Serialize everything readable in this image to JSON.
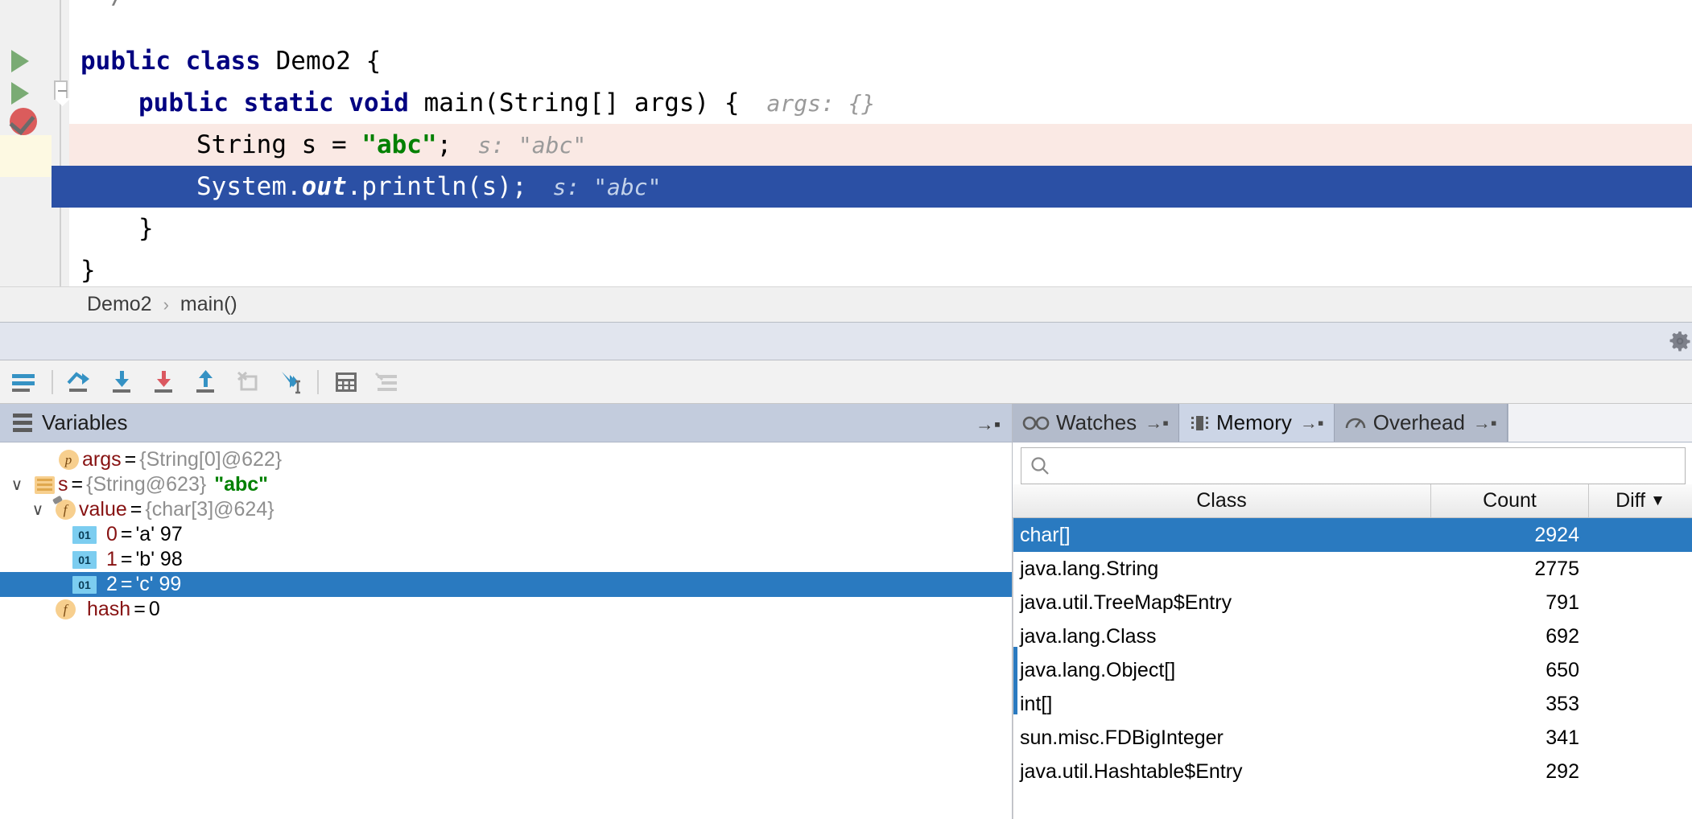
{
  "editor": {
    "top_fragment": "**/",
    "lines": [
      {
        "indent": 0,
        "segments": [
          {
            "t": "public ",
            "c": "kw"
          },
          {
            "t": "class ",
            "c": "kw"
          },
          {
            "t": "Demo2 {",
            "c": "plain"
          }
        ],
        "hint": "",
        "state": "normal",
        "gutter": "run-arrow",
        "fold": ""
      },
      {
        "indent": 1,
        "segments": [
          {
            "t": "public ",
            "c": "kw"
          },
          {
            "t": "static ",
            "c": "kw"
          },
          {
            "t": "void ",
            "c": "kw"
          },
          {
            "t": "main(String[] args) {",
            "c": "plain"
          }
        ],
        "hint": "args: {}",
        "state": "normal",
        "gutter": "run-arrow",
        "fold": "fold-minus"
      },
      {
        "indent": 2,
        "segments": [
          {
            "t": "String s = ",
            "c": "plain"
          },
          {
            "t": "\"abc\"",
            "c": "str"
          },
          {
            "t": ";",
            "c": "plain"
          }
        ],
        "hint": "s: \"abc\"",
        "state": "breakpoint",
        "gutter": "breakpoint",
        "fold": ""
      },
      {
        "indent": 2,
        "segments": [
          {
            "t": "System.",
            "c": "plain"
          },
          {
            "t": "out",
            "c": "fld"
          },
          {
            "t": ".println(s);",
            "c": "plain"
          }
        ],
        "hint": "s: \"abc\"",
        "state": "selected",
        "gutter": "",
        "fold": ""
      },
      {
        "indent": 1,
        "segments": [
          {
            "t": "}",
            "c": "plain"
          }
        ],
        "hint": "",
        "state": "normal",
        "gutter": "",
        "fold": "fold-up"
      },
      {
        "indent": 0,
        "segments": [
          {
            "t": "}",
            "c": "plain"
          }
        ],
        "hint": "",
        "state": "normal",
        "gutter": "",
        "fold": ""
      }
    ]
  },
  "breadcrumb": {
    "class_name": "Demo2",
    "separator": "›",
    "method_name": "main()"
  },
  "debug_toolbar": {
    "buttons": [
      {
        "name": "show-execution-point-icon",
        "label": "Show Execution Point"
      },
      {
        "name": "step-over-icon",
        "label": "Step Over"
      },
      {
        "name": "step-into-icon",
        "label": "Step Into"
      },
      {
        "name": "force-step-into-icon",
        "label": "Force Step Into"
      },
      {
        "name": "step-out-icon",
        "label": "Step Out"
      },
      {
        "name": "drop-frame-icon",
        "label": "Drop Frame"
      },
      {
        "name": "run-to-cursor-icon",
        "label": "Run to Cursor"
      },
      {
        "name": "evaluate-expression-icon",
        "label": "Evaluate Expression"
      },
      {
        "name": "mute-breakpoints-icon",
        "label": "Settings"
      }
    ]
  },
  "variables_panel": {
    "title": "Variables",
    "pin_glyph": "→▪",
    "rows": [
      {
        "depth": 0,
        "twisty": "",
        "icon": "param",
        "icon_text": "p",
        "name": "args",
        "eq": "=",
        "ref": "{String[0]@622}",
        "value": "",
        "num": "",
        "selected": false
      },
      {
        "depth": 0,
        "twisty": "∨",
        "icon": "array",
        "icon_text": "",
        "name": "s",
        "eq": "=",
        "ref": "{String@623}",
        "value": "\"abc\"",
        "num": "",
        "selected": false
      },
      {
        "depth": 1,
        "twisty": "∨",
        "icon": "field-wrench",
        "icon_text": "f",
        "name": "value",
        "eq": "=",
        "ref": "{char[3]@624}",
        "value": "",
        "num": "",
        "selected": false
      },
      {
        "depth": 2,
        "twisty": "",
        "icon": "prim01",
        "icon_text": "01",
        "name": "0",
        "eq": "=",
        "ref": "",
        "value": "'a' 97",
        "num": "",
        "selected": false
      },
      {
        "depth": 2,
        "twisty": "",
        "icon": "prim01",
        "icon_text": "01",
        "name": "1",
        "eq": "=",
        "ref": "",
        "value": "'b' 98",
        "num": "",
        "selected": false
      },
      {
        "depth": 2,
        "twisty": "",
        "icon": "prim01",
        "icon_text": "01",
        "name": "2",
        "eq": "=",
        "ref": "",
        "value": "'c' 99",
        "num": "",
        "selected": true
      },
      {
        "depth": 1,
        "twisty": "",
        "icon": "field",
        "icon_text": "f",
        "name": "hash",
        "eq": "=",
        "ref": "",
        "value": "0",
        "num": "",
        "selected": false
      }
    ]
  },
  "right_panel": {
    "tabs": [
      {
        "label": "Watches",
        "icon": "glasses-icon",
        "pin": "→▪",
        "active": false
      },
      {
        "label": "Memory",
        "icon": "memory-chip-icon",
        "pin": "→▪",
        "active": true
      },
      {
        "label": "Overhead",
        "icon": "gauge-icon",
        "pin": "→▪",
        "active": false
      }
    ],
    "search": {
      "placeholder": "",
      "value": ""
    },
    "memory_table": {
      "columns": [
        "Class",
        "Count",
        "Diff"
      ],
      "sort_indicator": "▼",
      "rows": [
        {
          "class": "char[]",
          "count": "2924",
          "diff": "",
          "selected": true
        },
        {
          "class": "java.lang.String",
          "count": "2775",
          "diff": "",
          "selected": false
        },
        {
          "class": "java.util.TreeMap$Entry",
          "count": "791",
          "diff": "",
          "selected": false
        },
        {
          "class": "java.lang.Class",
          "count": "692",
          "diff": "",
          "selected": false
        },
        {
          "class": "java.lang.Object[]",
          "count": "650",
          "diff": "",
          "selected": false
        },
        {
          "class": "int[]",
          "count": "353",
          "diff": "",
          "selected": false
        },
        {
          "class": "sun.misc.FDBigInteger",
          "count": "341",
          "diff": "",
          "selected": false
        },
        {
          "class": "java.util.Hashtable$Entry",
          "count": "292",
          "diff": "",
          "selected": false
        }
      ]
    }
  },
  "colors": {
    "selection_blue": "#2b50a5",
    "table_selection_blue": "#2a7ac0",
    "breakpoint_line": "#fae9e4",
    "keyword": "#000080",
    "string": "#008000",
    "panel_header": "#c3ccdd"
  }
}
